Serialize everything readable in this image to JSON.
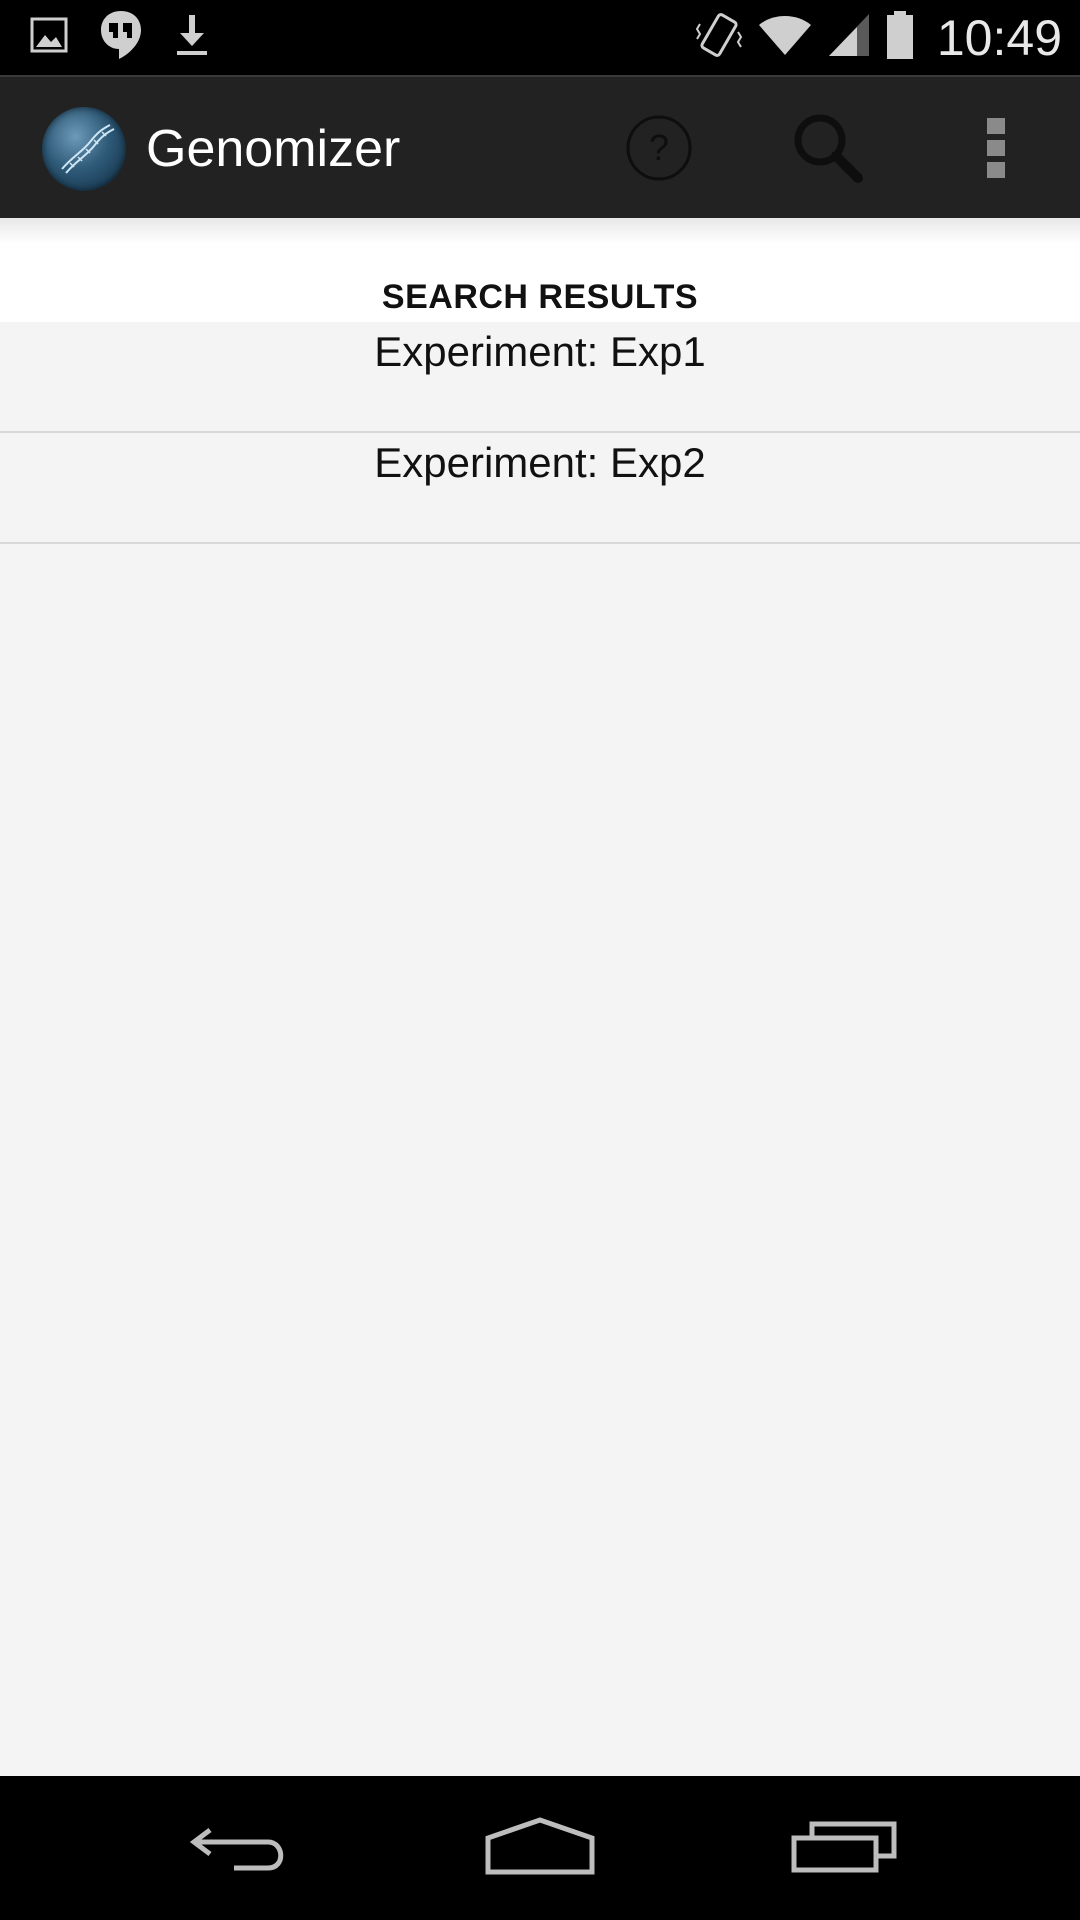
{
  "status_bar": {
    "left_icons": [
      "gallery-icon",
      "hangouts-icon",
      "download-icon"
    ],
    "right_icons": [
      "vibrate-icon",
      "wifi-icon",
      "signal-icon",
      "battery-icon"
    ],
    "time": "10:49"
  },
  "action_bar": {
    "app_title": "Genomizer",
    "actions": [
      "help-icon",
      "search-icon",
      "overflow-menu-icon"
    ]
  },
  "results": {
    "title": "SEARCH RESULTS",
    "items": [
      {
        "label": "Experiment: Exp1"
      },
      {
        "label": "Experiment: Exp2"
      }
    ]
  },
  "nav_bar": {
    "buttons": [
      "back-icon",
      "home-icon",
      "recents-icon"
    ]
  },
  "colors": {
    "status_bar_bg": "#000000",
    "action_bar_bg": "#222222",
    "content_bg": "#f4f4f4",
    "divider": "#d8d8d8"
  }
}
